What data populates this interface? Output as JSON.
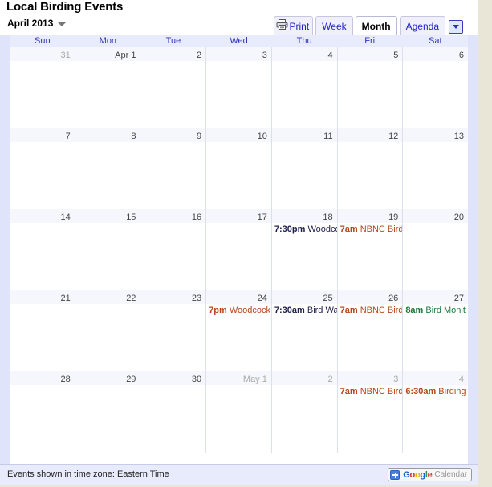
{
  "header": {
    "title": "Local Birding Events",
    "period": "April 2013",
    "period_caret_icon": "chevron-down-icon"
  },
  "toolbar": {
    "print_label": "Print",
    "print_icon": "printer-icon",
    "views": [
      {
        "label": "Week",
        "active": false
      },
      {
        "label": "Month",
        "active": true
      },
      {
        "label": "Agenda",
        "active": false
      }
    ],
    "dropdown_icon": "caret-down-icon"
  },
  "calendar": {
    "day_headers": [
      "Sun",
      "Mon",
      "Tue",
      "Wed",
      "Thu",
      "Fri",
      "Sat"
    ],
    "weeks": [
      {
        "days": [
          {
            "num": "31",
            "muted": true,
            "events": []
          },
          {
            "num": "Apr 1",
            "muted": false,
            "events": []
          },
          {
            "num": "2",
            "muted": false,
            "events": []
          },
          {
            "num": "3",
            "muted": false,
            "events": []
          },
          {
            "num": "4",
            "muted": false,
            "events": []
          },
          {
            "num": "5",
            "muted": false,
            "events": []
          },
          {
            "num": "6",
            "muted": false,
            "events": []
          }
        ]
      },
      {
        "days": [
          {
            "num": "7",
            "muted": false,
            "events": []
          },
          {
            "num": "8",
            "muted": false,
            "events": []
          },
          {
            "num": "9",
            "muted": false,
            "events": []
          },
          {
            "num": "10",
            "muted": false,
            "events": []
          },
          {
            "num": "11",
            "muted": false,
            "events": []
          },
          {
            "num": "12",
            "muted": false,
            "events": []
          },
          {
            "num": "13",
            "muted": false,
            "events": []
          }
        ]
      },
      {
        "days": [
          {
            "num": "14",
            "muted": false,
            "events": []
          },
          {
            "num": "15",
            "muted": false,
            "events": []
          },
          {
            "num": "16",
            "muted": false,
            "events": []
          },
          {
            "num": "17",
            "muted": false,
            "events": []
          },
          {
            "num": "18",
            "muted": false,
            "events": [
              {
                "time": "7:30pm",
                "title": "Woodcock",
                "color": "#1f1f4d"
              }
            ]
          },
          {
            "num": "19",
            "muted": false,
            "events": [
              {
                "time": "7am",
                "title": "NBNC Bird",
                "color": "#b9441a"
              }
            ]
          },
          {
            "num": "20",
            "muted": false,
            "events": []
          }
        ]
      },
      {
        "days": [
          {
            "num": "21",
            "muted": false,
            "events": []
          },
          {
            "num": "22",
            "muted": false,
            "events": []
          },
          {
            "num": "23",
            "muted": false,
            "events": []
          },
          {
            "num": "24",
            "muted": false,
            "events": [
              {
                "time": "7pm",
                "title": "Woodcock",
                "color": "#b9441a"
              }
            ]
          },
          {
            "num": "25",
            "muted": false,
            "events": [
              {
                "time": "7:30am",
                "title": "Bird Wa",
                "color": "#1f1f4d"
              }
            ]
          },
          {
            "num": "26",
            "muted": false,
            "events": [
              {
                "time": "7am",
                "title": "NBNC Bird",
                "color": "#b9441a"
              }
            ]
          },
          {
            "num": "27",
            "muted": false,
            "events": [
              {
                "time": "8am",
                "title": "Bird Monit",
                "color": "#1a7a3c"
              }
            ]
          }
        ]
      },
      {
        "days": [
          {
            "num": "28",
            "muted": false,
            "events": []
          },
          {
            "num": "29",
            "muted": false,
            "events": []
          },
          {
            "num": "30",
            "muted": false,
            "events": []
          },
          {
            "num": "May 1",
            "muted": true,
            "events": []
          },
          {
            "num": "2",
            "muted": true,
            "events": []
          },
          {
            "num": "3",
            "muted": true,
            "events": [
              {
                "time": "7am",
                "title": "NBNC Bird",
                "color": "#b9441a"
              }
            ]
          },
          {
            "num": "4",
            "muted": true,
            "events": [
              {
                "time": "6:30am",
                "title": "Birding",
                "color": "#b9441a"
              }
            ]
          }
        ]
      }
    ]
  },
  "footer": {
    "timezone_note": "Events shown in time zone: Eastern Time",
    "google_logo_letters": [
      "G",
      "o",
      "o",
      "g",
      "l",
      "e"
    ],
    "calendar_word": "Calendar",
    "add_icon": "plus-icon"
  }
}
